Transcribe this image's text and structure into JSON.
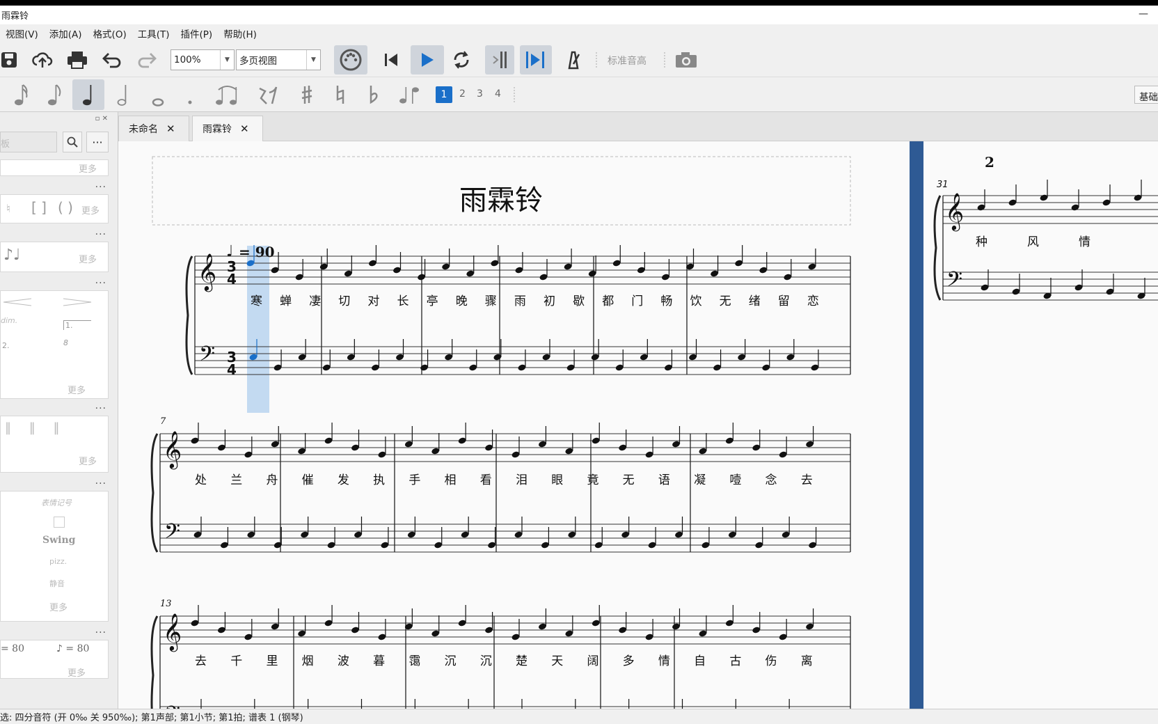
{
  "window": {
    "title": "雨霖铃",
    "minimize": "—"
  },
  "menu": [
    "视图(V)",
    "添加(A)",
    "格式(O)",
    "工具(T)",
    "插件(P)",
    "帮助(H)"
  ],
  "toolbar": {
    "zoom": "100%",
    "view_mode": "多页视图",
    "concert_pitch": "标准音高"
  },
  "note_input": {
    "voices": [
      "1",
      "2",
      "3",
      "4"
    ],
    "workspace": "基础"
  },
  "palette": {
    "search_placeholder": "板",
    "more": "更多",
    "expression": "表情记号",
    "swing": "Swing",
    "pizz": "pizz.",
    "mute": "静音",
    "dim": "dim.",
    "volta1": "1.",
    "volta2": "2.",
    "ottava": "8",
    "tempo_q": "= 80",
    "tempo_e": "= 80"
  },
  "tabs": [
    {
      "label": "未命名"
    },
    {
      "label": "雨霖铃"
    }
  ],
  "score": {
    "title": "雨霖铃",
    "tempo_value": "= 90",
    "time_sig": [
      "3",
      "4"
    ],
    "system2_measure": "7",
    "system3_measure": "13",
    "page2_number": "2",
    "page2_measure": "31",
    "lyrics_row1": [
      "寒",
      "蝉",
      "凄",
      "切",
      "对",
      "长",
      "亭",
      "晚",
      "骤",
      "雨",
      "初",
      "歇",
      "都",
      "门",
      "畅",
      "饮",
      "无",
      "绪",
      "留",
      "恋"
    ],
    "lyrics_row2": [
      "处",
      "兰",
      "舟",
      "催",
      "发",
      "执",
      "手",
      "相",
      "看",
      "泪",
      "眼",
      "竟",
      "无",
      "语",
      "凝",
      "噎",
      "念",
      "去"
    ],
    "lyrics_row3": [
      "去",
      "千",
      "里",
      "烟",
      "波",
      "暮",
      "霭",
      "沉",
      "沉",
      "楚",
      "天",
      "阔",
      "多",
      "情",
      "自",
      "古",
      "伤",
      "离"
    ],
    "lyrics_page2": [
      "种",
      "风",
      "情"
    ]
  },
  "status": "选: 四分音符 (开 0‰ 关 950‰); 第1声部;  第1小节; 第1拍; 谱表 1 (钢琴)"
}
